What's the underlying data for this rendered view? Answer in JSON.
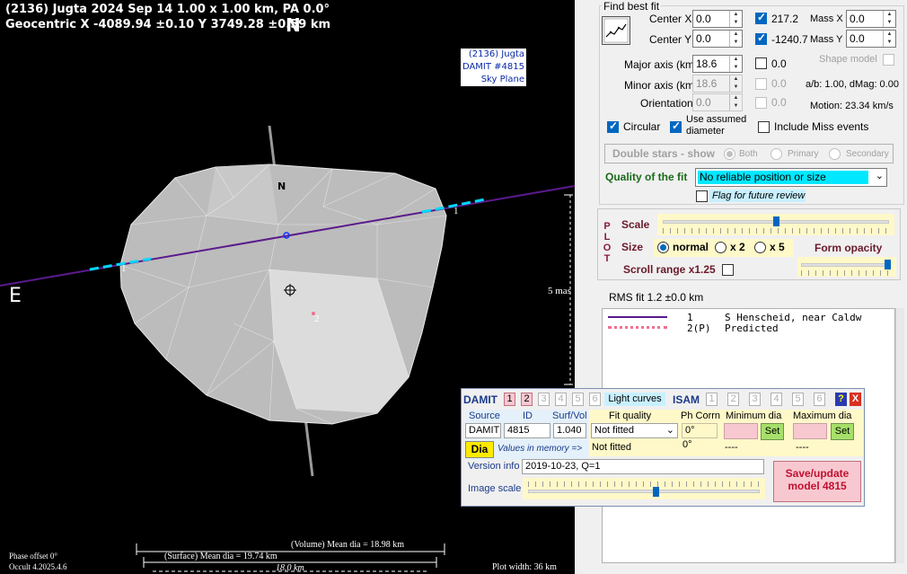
{
  "plot": {
    "title_line1": "(2136) Jugta  2024 Sep 14   1.00 x 1.00 km, PA 0.0°",
    "title_line2": "Geocentric  X  -4089.94 ±0.10  Y 3749.28 ±0.59 km",
    "north_marker": "N",
    "east_marker": "E",
    "model_label": [
      "(2136) Jugta",
      "DAMIT #4815",
      "Sky Plane"
    ],
    "body_north": "N",
    "chord1_label_left": "1",
    "chord1_label_right": "1",
    "chord2_label": "2",
    "scale_label": "5 mas",
    "phase_offset": "Phase offset 0°",
    "version": "Occult 4.2025.4.6",
    "volume_mean_dia": "(Volume) Mean dia = 18.98 km",
    "surface_mean_dia": "(Surface) Mean dia = 19.74 km",
    "axis_length": "18.0 km",
    "plot_width": "Plot width: 36 km"
  },
  "fit_panel": {
    "title": "Find best fit",
    "center_x_label": "Center X",
    "center_x_value": "0.0",
    "center_y_label": "Center Y",
    "center_y_value": "0.0",
    "fit_x_value": "217.2",
    "fit_y_value": "-1240.7",
    "mass_x_label": "Mass X",
    "mass_x_value": "0.0",
    "mass_y_label": "Mass Y",
    "mass_y_value": "0.0",
    "major_axis_label": "Major axis (km)",
    "major_axis_value": "18.6",
    "major_axis_fit": "0.0",
    "shape_model_label": "Shape model",
    "minor_axis_label": "Minor axis (km)",
    "minor_axis_value": "18.6",
    "minor_axis_fit": "0.0",
    "ab_dmag": "a/b: 1.00, dMag: 0.00",
    "orientation_label": "Orientation",
    "orientation_value": "0.0",
    "orientation_fit": "0.0",
    "motion": "Motion: 23.34 km/s",
    "circular_label": "Circular",
    "assumed_diameter_label": "Use assumed diameter",
    "include_miss_label": "Include Miss events",
    "double_stars_label": "Double stars - show",
    "radio_both": "Both",
    "radio_primary": "Primary",
    "radio_secondary": "Secondary",
    "quality_label": "Quality of the fit",
    "quality_value": "No reliable position or size",
    "flag_label": "Flag for future review"
  },
  "plot_panel": {
    "vertical_title": [
      "P",
      "L",
      "O",
      "T"
    ],
    "scale_label": "Scale",
    "scale_value": 0.5,
    "size_label": "Size",
    "size_normal": "normal",
    "size_x2": "x 2",
    "size_x5": "x 5",
    "form_opacity_label": "Form opacity",
    "form_opacity_value": 0.96,
    "scroll_range_label": "Scroll range x1.25",
    "rms_fit": "RMS fit 1.2 ±0.0 km"
  },
  "legend": [
    {
      "number": "1",
      "text": "S Henscheid, near Caldw",
      "style": "solid",
      "color": "#5a1a8c"
    },
    {
      "number": "2(P)",
      "text": "Predicted",
      "style": "dotted",
      "color": "#f07090"
    }
  ],
  "damit": {
    "title": "DAMIT",
    "model_numbers": [
      "1",
      "2",
      "3",
      "4",
      "5",
      "6"
    ],
    "light_curves_label": "Light curves",
    "isam_title": "ISAM",
    "isam_numbers": [
      "1",
      "2",
      "3",
      "4",
      "5",
      "6"
    ],
    "help_label": "?",
    "close_label": "X",
    "source_header": "Source",
    "id_header": "ID",
    "surf_vol_header": "Surf/Vol",
    "fit_quality_header": "Fit quality",
    "ph_corrn_header": "Ph Corrn",
    "min_dia_header": "Minimum dia",
    "max_dia_header": "Maximum dia",
    "source_value": "DAMIT",
    "id_value": "4815",
    "surf_vol_value": "1.040",
    "fit_quality_select": "Not fitted",
    "fit_quality_memory": "Not fitted",
    "ph_corrn_value": "0°",
    "ph_corrn_memory": "0°",
    "min_dia_memory": "----",
    "max_dia_memory": "----",
    "set_label": "Set",
    "dia_label": "Dia",
    "values_in_memory": "Values in memory =>",
    "version_info_label": "Version info",
    "version_info_value": "2019-10-23, Q=1",
    "image_scale_label": "Image scale",
    "image_scale_value": 0.55,
    "save_button": "Save/update model 4815"
  }
}
